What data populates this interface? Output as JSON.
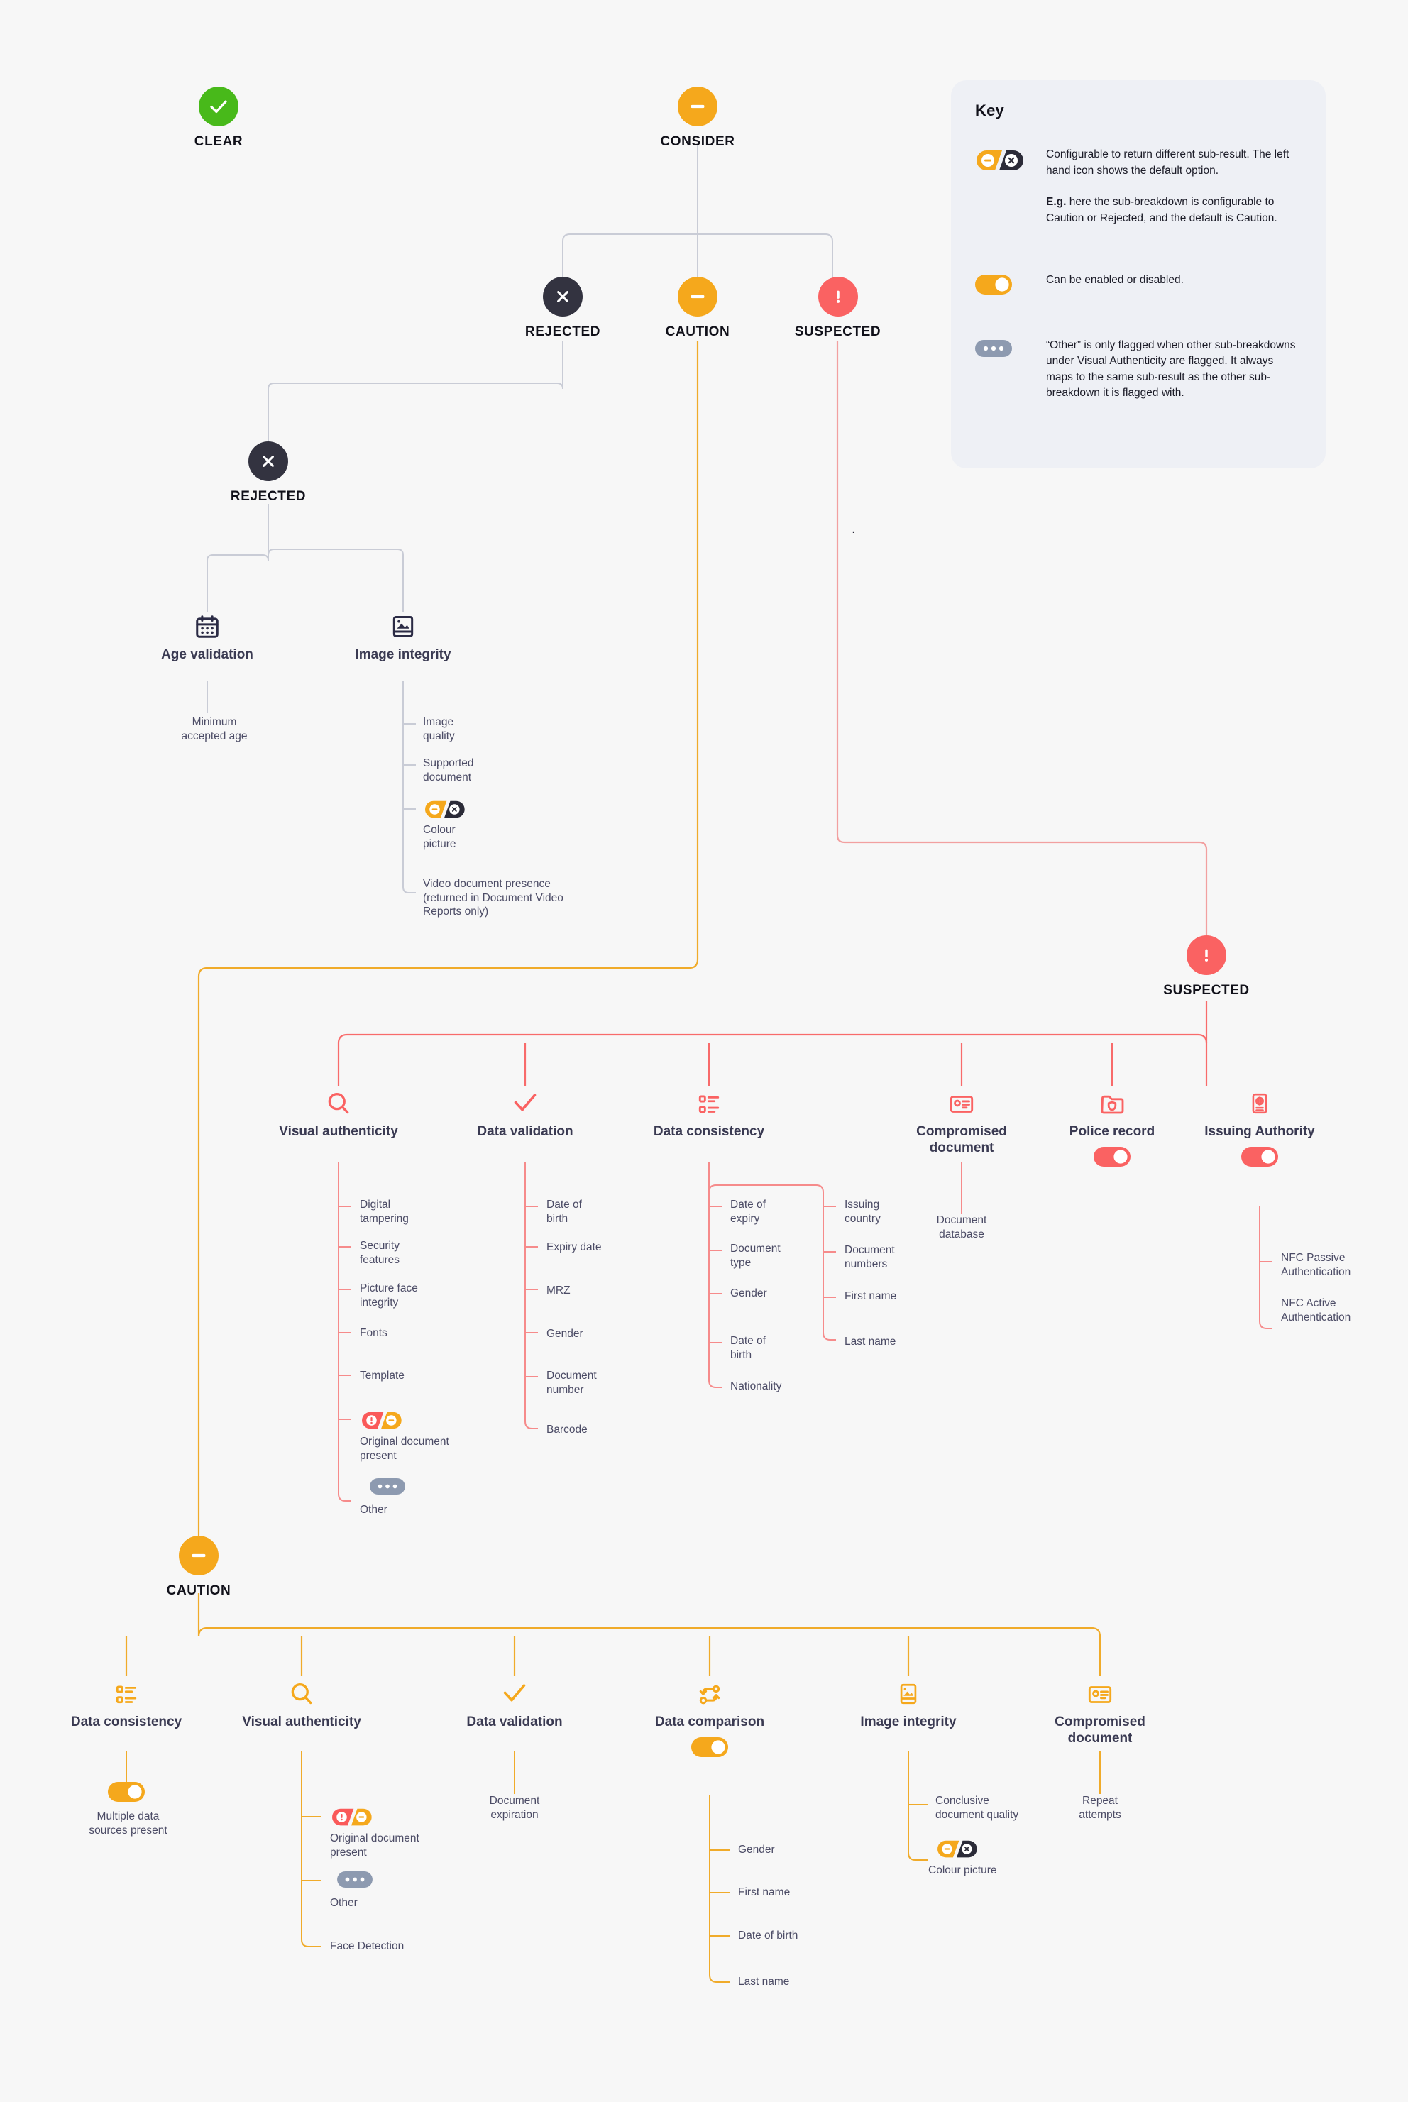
{
  "meta": {
    "title": "Document report sub-result breakdown",
    "background": "#f7f7f7"
  },
  "colors": {
    "clear_green": "#48b91a",
    "consider_amber": "#f5a81c",
    "rejected_dark": "#333340",
    "suspected_red": "#fa6262",
    "caution_amber": "#f5a81c",
    "grey_line": "#c9ccd6",
    "other_grey": "#8d9ab0",
    "text_dark": "#3a3a52"
  },
  "top": {
    "clear": {
      "label": "CLEAR",
      "icon": "check-icon",
      "color": "#48b91a"
    },
    "consider": {
      "label": "CONSIDER",
      "icon": "minus-icon",
      "color": "#f5a81c"
    }
  },
  "consider_children": [
    {
      "label": "REJECTED",
      "icon": "cross-icon",
      "color": "#333340"
    },
    {
      "label": "CAUTION",
      "icon": "minus-icon",
      "color": "#f5a81c"
    },
    {
      "label": "SUSPECTED",
      "icon": "exclamation-icon",
      "color": "#fa6262"
    }
  ],
  "key": {
    "title": "Key",
    "rows": [
      {
        "icon": "split-toggle-amber-dark",
        "text": "Configurable to return different sub-result. The left hand icon shows the default option.",
        "text2_bold": "E.g.",
        "text2": " here the sub-breakdown is configurable to Caution or Rejected, and the default is Caution."
      },
      {
        "icon": "toggle-on-amber",
        "text": "Can be enabled or disabled."
      },
      {
        "icon": "other-dots",
        "text": "“Other” is only flagged when other sub-breakdowns under Visual Authenticity are flagged. It always maps to the same sub-result as the other sub-breakdown it is flagged with."
      }
    ]
  },
  "rejected_branch": {
    "header": {
      "label": "REJECTED",
      "icon": "cross-icon",
      "color": "#333340"
    },
    "categories": [
      {
        "name": "Age\nvalidation",
        "icon": "calendar-icon",
        "leaves": [
          {
            "text": "Minimum\naccepted age"
          }
        ]
      },
      {
        "name": "Image\nintegrity",
        "icon": "image-icon",
        "leaves": [
          {
            "text": "Image\nquality"
          },
          {
            "text": "Supported\ndocument"
          },
          {
            "text": "Colour\npicture",
            "toggle": "split-toggle-amber-dark"
          },
          {
            "text": "Video document presence\n(returned in Document Video\nReports only)"
          }
        ]
      }
    ]
  },
  "suspected_branch": {
    "header": {
      "label": "SUSPECTED",
      "icon": "exclamation-icon",
      "color": "#fa6262"
    },
    "categories": [
      {
        "name": "Visual\nauthenticity",
        "icon": "magnifier-icon",
        "leaves": [
          {
            "text": "Digital\ntampering"
          },
          {
            "text": "Security\nfeatures"
          },
          {
            "text": "Picture face\nintegrity"
          },
          {
            "text": "Fonts"
          },
          {
            "text": "Template"
          },
          {
            "text": "Original document\npresent",
            "toggle": "split-toggle-red-amber"
          },
          {
            "text": "Other",
            "toggle": "other-dots"
          }
        ]
      },
      {
        "name": "Data\nvalidation",
        "icon": "tick-icon",
        "leaves": [
          {
            "text": "Date of\nbirth"
          },
          {
            "text": "Expiry date"
          },
          {
            "text": "MRZ"
          },
          {
            "text": "Gender"
          },
          {
            "text": "Document\nnumber"
          },
          {
            "text": "Barcode"
          }
        ]
      },
      {
        "name": "Data\nconsistency",
        "icon": "list-icon",
        "leaves": [
          {
            "text": "Date of\nexpiry"
          },
          {
            "text": "Document\ntype"
          },
          {
            "text": "Gender"
          },
          {
            "text": "Date of\nbirth"
          },
          {
            "text": "Nationality"
          }
        ],
        "leaves_col2": [
          {
            "text": "Issuing\ncountry"
          },
          {
            "text": "Document\nnumbers"
          },
          {
            "text": "First name"
          },
          {
            "text": "Last name"
          }
        ]
      },
      {
        "name": "Compromised\ndocument",
        "icon": "id-card-icon",
        "leaves": [
          {
            "text": "Document\ndatabase"
          }
        ]
      },
      {
        "name": "Police\nrecord",
        "icon": "police-folder-icon",
        "toggle": "toggle-on-red",
        "leaves": []
      },
      {
        "name": "Issuing\nAuthority",
        "icon": "passport-globe-icon",
        "toggle": "toggle-on-red",
        "leaves": [
          {
            "text": "NFC Passive\nAuthentication"
          },
          {
            "text": "NFC Active\nAuthentication"
          }
        ]
      }
    ]
  },
  "caution_branch": {
    "header": {
      "label": "CAUTION",
      "icon": "minus-icon",
      "color": "#f5a81c"
    },
    "categories": [
      {
        "name": "Data\nconsistency",
        "icon": "list-icon",
        "toggle": "toggle-on-amber",
        "leaves": [
          {
            "text": "Multiple data\nsources present"
          }
        ]
      },
      {
        "name": "Visual\nauthenticity",
        "icon": "magnifier-icon",
        "leaves": [
          {
            "text": "Original document\npresent",
            "toggle": "split-toggle-red-amber"
          },
          {
            "text": "Other",
            "toggle": "other-dots"
          },
          {
            "text": "Face Detection"
          }
        ]
      },
      {
        "name": "Data\nvalidation",
        "icon": "tick-icon",
        "leaves": [
          {
            "text": "Document\nexpiration"
          }
        ]
      },
      {
        "name": "Data\ncomparison",
        "icon": "compare-icon",
        "toggle": "toggle-on-amber",
        "leaves": [
          {
            "text": "Gender"
          },
          {
            "text": "First name"
          },
          {
            "text": "Date of birth"
          },
          {
            "text": "Last name"
          }
        ]
      },
      {
        "name": "Image\nintegrity",
        "icon": "image-icon",
        "leaves": [
          {
            "text": "Conclusive\ndocument quality"
          },
          {
            "text": "Colour picture",
            "toggle": "split-toggle-amber-dark"
          }
        ]
      },
      {
        "name": "Compromised\ndocument",
        "icon": "id-card-icon",
        "leaves": [
          {
            "text": "Repeat\nattempts"
          }
        ]
      }
    ]
  },
  "stray_period": "."
}
